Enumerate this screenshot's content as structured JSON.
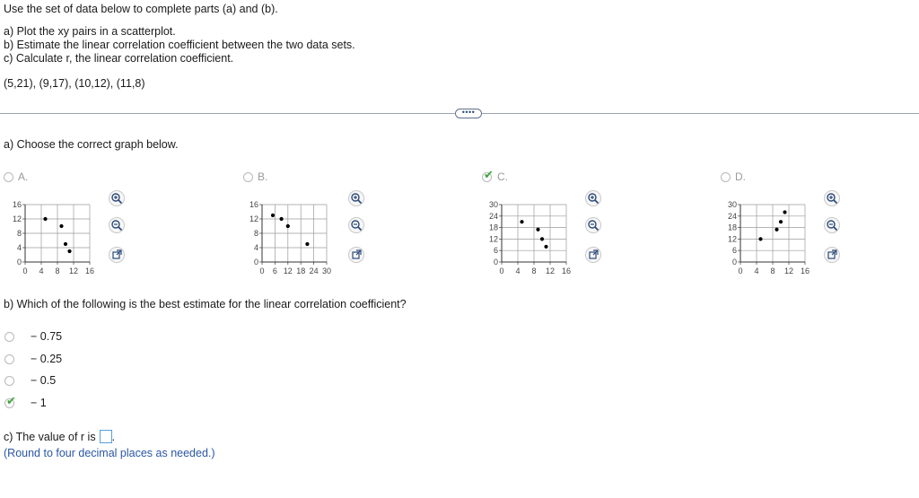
{
  "intro": {
    "instruction": "Use the set of data below to complete parts (a) and (b).",
    "part_a": "a) Plot the xy pairs in a scatterplot.",
    "part_b": "b) Estimate the linear correlation coefficient between the two data sets.",
    "part_c": "c) Calculate r, the linear correlation coefficient.",
    "data_pairs": "(5,21), (9,17), (10,12), (11,8)"
  },
  "more_button": "••••",
  "question_a": {
    "prompt": "a) Choose the correct graph below.",
    "options": [
      {
        "letter": "A.",
        "selected": false
      },
      {
        "letter": "B.",
        "selected": false
      },
      {
        "letter": "C.",
        "selected": true
      },
      {
        "letter": "D.",
        "selected": false
      }
    ]
  },
  "chart_data": [
    {
      "type": "scatter",
      "title": "A.",
      "xlim": [
        0,
        16
      ],
      "ylim": [
        0,
        16
      ],
      "xticks": [
        "0",
        "4",
        "8",
        "12",
        "16"
      ],
      "yticks": [
        "0",
        "4",
        "8",
        "12",
        "16"
      ],
      "x": [
        5,
        9,
        10,
        11
      ],
      "y": [
        12,
        10,
        5,
        3
      ],
      "grid": true
    },
    {
      "type": "scatter",
      "title": "B.",
      "xlim": [
        0,
        30
      ],
      "ylim": [
        0,
        16
      ],
      "xticks": [
        "0",
        "6",
        "12",
        "18",
        "24",
        "30"
      ],
      "yticks": [
        "0",
        "4",
        "8",
        "12",
        "16"
      ],
      "x": [
        5,
        9,
        12,
        21
      ],
      "y": [
        13,
        12,
        10,
        5
      ],
      "grid": true
    },
    {
      "type": "scatter",
      "title": "C.",
      "xlim": [
        0,
        16
      ],
      "ylim": [
        0,
        30
      ],
      "xticks": [
        "0",
        "4",
        "8",
        "12",
        "16"
      ],
      "yticks": [
        "0",
        "6",
        "12",
        "18",
        "24",
        "30"
      ],
      "x": [
        5,
        9,
        10,
        11
      ],
      "y": [
        21,
        17,
        12,
        8
      ],
      "grid": true
    },
    {
      "type": "scatter",
      "title": "D.",
      "xlim": [
        0,
        16
      ],
      "ylim": [
        0,
        30
      ],
      "xticks": [
        "0",
        "4",
        "8",
        "12",
        "16"
      ],
      "yticks": [
        "0",
        "6",
        "12",
        "18",
        "24",
        "30"
      ],
      "x": [
        5,
        9,
        10,
        11
      ],
      "y": [
        12,
        17,
        21,
        26
      ],
      "grid": true
    }
  ],
  "question_b": {
    "prompt": "b) Which of the following is the best estimate for the linear correlation coefficient?",
    "options": [
      {
        "label": "− 0.75",
        "selected": false
      },
      {
        "label": "− 0.25",
        "selected": false
      },
      {
        "label": "− 0.5",
        "selected": false
      },
      {
        "label": "− 1",
        "selected": true
      }
    ]
  },
  "question_c": {
    "prompt": "c) The value of r is",
    "value": "",
    "period": ".",
    "hint": "(Round to four decimal places as needed.)"
  },
  "colors": {
    "check": "#3ba53b",
    "link": "#2a57a6",
    "divider": "#9aa3b0"
  }
}
